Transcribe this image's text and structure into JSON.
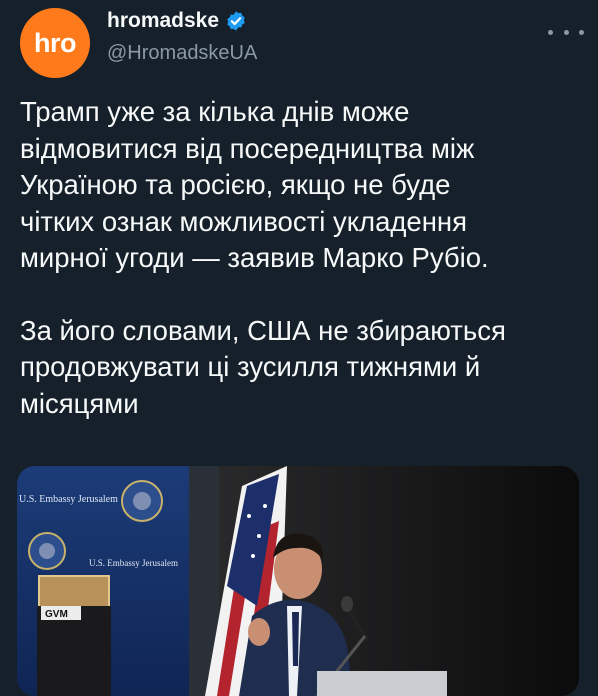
{
  "account": {
    "avatar_text": "hro",
    "display_name": "hromadske",
    "handle": "@HromadskeUA",
    "avatar_color": "#ff7a1a",
    "verified_color": "#1d9bf0"
  },
  "tweet": {
    "paragraph_1": "Трамп уже за кілька днів може\nвідмовитися від посередництва між\nУкраїною та росією, якщо не буде\nчітких ознак можливості укладення\nмирної угоди — заявив Марко Рубіо.",
    "paragraph_2": "За його словами, США не збираються\nпродовжувати ці зусилля тижнями й\nмісяцями"
  },
  "media": {
    "banner_text_1": "U.S. Embassy Jerusalem",
    "banner_text_2": "U.S. Embassy Jerusalem",
    "sign_text": "GVM"
  },
  "icons": {
    "more": "more-options-icon",
    "verified": "verified-badge-icon"
  }
}
